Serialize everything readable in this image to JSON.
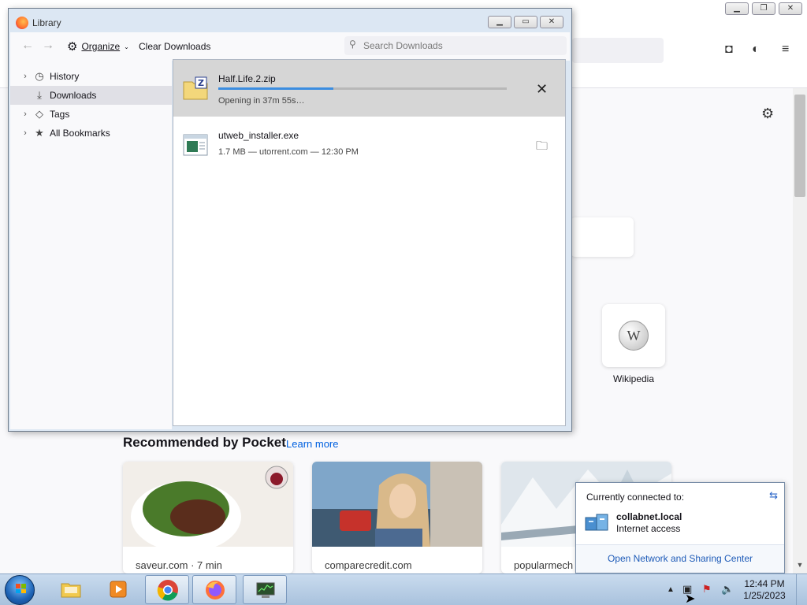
{
  "browser": {
    "wikipedia_label": "Wikipedia",
    "pocket": {
      "title": "Recommended by Pocket",
      "learn_more": "Learn more",
      "cards": [
        {
          "source": "saveur.com · 7 min"
        },
        {
          "source": "comparecredit.com"
        },
        {
          "source": "popularmech"
        }
      ]
    }
  },
  "library": {
    "title": "Library",
    "toolbar": {
      "organize_label": "Organize",
      "clear_label": "Clear Downloads",
      "search_placeholder": "Search Downloads"
    },
    "sidebar": [
      {
        "label": "History",
        "icon": "clock-icon"
      },
      {
        "label": "Downloads",
        "icon": "download-icon",
        "selected": true
      },
      {
        "label": "Tags",
        "icon": "tag-icon"
      },
      {
        "label": "All Bookmarks",
        "icon": "star-icon"
      }
    ],
    "downloads": [
      {
        "name": "Half.Life.2.zip",
        "status": "Opening in 37m 55s…",
        "progress": 0.4
      },
      {
        "name": "utweb_installer.exe",
        "status": "1.7 MB — utorrent.com — 12:30 PM"
      }
    ]
  },
  "network": {
    "header": "Currently connected to:",
    "name": "collabnet.local",
    "access": "Internet access",
    "link": "Open Network and Sharing Center"
  },
  "taskbar": {
    "time": "12:44 PM",
    "date": "1/25/2023"
  },
  "colors": {
    "accent": "#0061e0",
    "progress": "#3b8de0",
    "taskbar": "#b9cfe6"
  }
}
